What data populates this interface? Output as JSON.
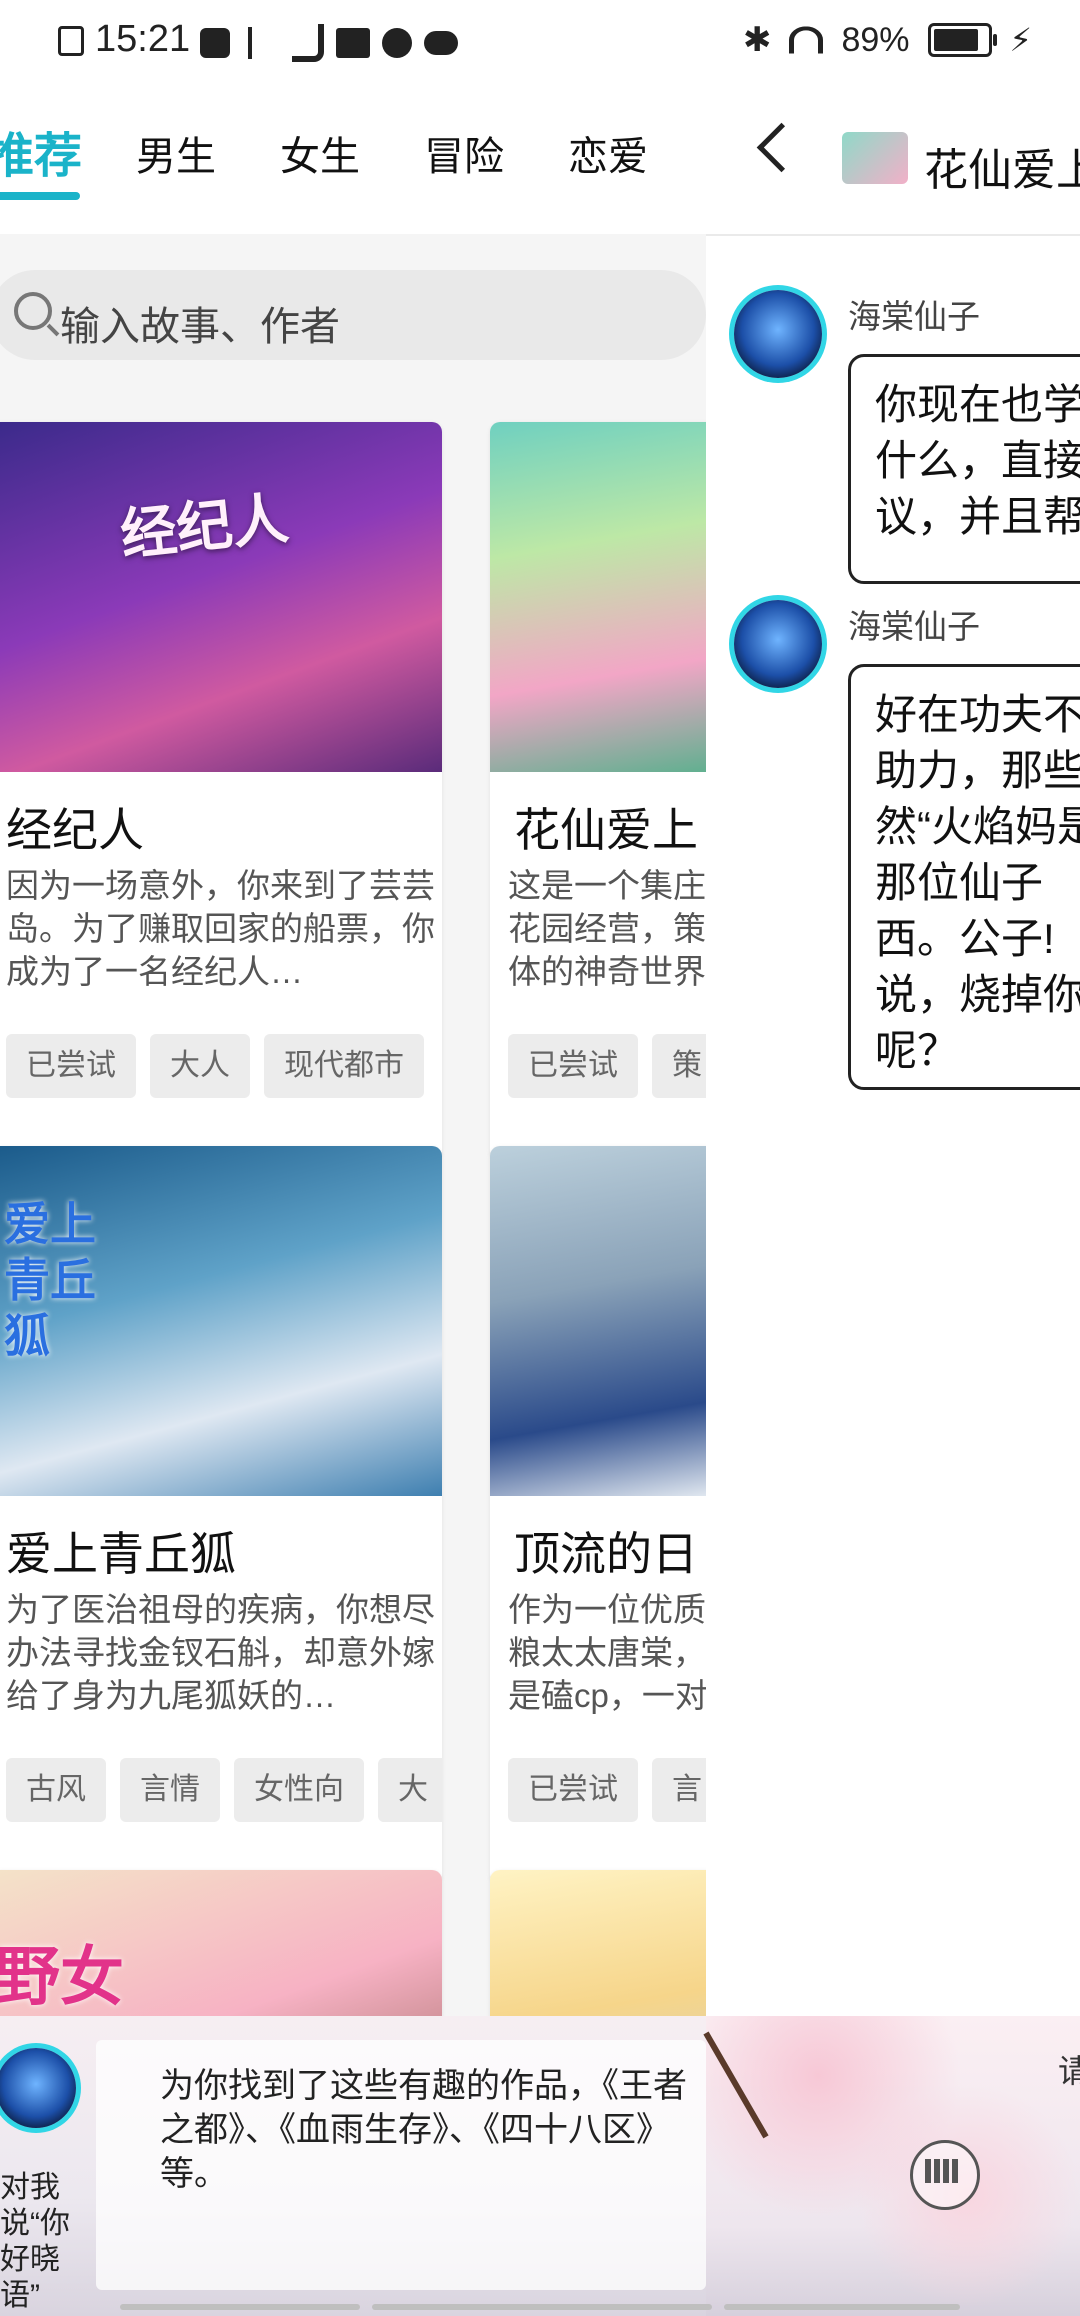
{
  "status_bar": {
    "time": "15:21",
    "battery": "89%",
    "icons": [
      "close-box-icon",
      "video-icon",
      "usb-icon",
      "tiktok-icon",
      "book-icon",
      "audio-icon",
      "cloud-icon",
      "bluetooth-icon",
      "wifi-icon",
      "battery-icon",
      "charging-icon"
    ]
  },
  "left_panel": {
    "tabs": [
      {
        "label": "推荐",
        "active": true
      },
      {
        "label": "男生"
      },
      {
        "label": "女生"
      },
      {
        "label": "冒险"
      },
      {
        "label": "恋爱"
      }
    ],
    "search": {
      "placeholder": "输入故事、作者"
    },
    "cards": [
      {
        "title": "经纪人",
        "image_text": "经纪人",
        "desc": "因为一场意外，你来到了芸芸岛。为了赚取回家的船票，你成为了一名经纪人…",
        "tags": [
          "已尝试",
          "大人",
          "现代都市"
        ]
      },
      {
        "title": "花仙爱上",
        "desc": "这是一个集庄花园经营，策体的神奇世界",
        "tags": [
          "已尝试",
          "策"
        ]
      },
      {
        "title": "爱上青丘狐",
        "image_text": "爱上青丘狐",
        "desc": "为了医治祖母的疾病，你想尽办法寻找金钗石斛，却意外嫁给了身为九尾狐妖的…",
        "tags": [
          "古风",
          "言情",
          "女性向",
          "大"
        ]
      },
      {
        "title": "顶流的日",
        "desc": "作为一位优质粮太太唐棠，是磕cp，一对",
        "tags": [
          "已尝试",
          "言"
        ]
      },
      {
        "title": "",
        "image_text": "野女"
      },
      {
        "title": ""
      }
    ]
  },
  "right_panel": {
    "title": "花仙爱上",
    "messages": [
      {
        "speaker": "海棠仙子",
        "text": "你现在也学什么，直接议，并且帮"
      },
      {
        "speaker": "海棠仙子",
        "text": "好在功夫不助力，那些然“火焰妈是那位仙子西。公子!说，烧掉你呢？"
      }
    ]
  },
  "bottom_bar": {
    "hint": "对我说“你好晓语”",
    "message": "为你找到了这些有趣的作品，《王者之都》、《血雨生存》、《四十八区》等。",
    "side_text": "请"
  },
  "colors": {
    "accent": "#1ab3c9"
  }
}
